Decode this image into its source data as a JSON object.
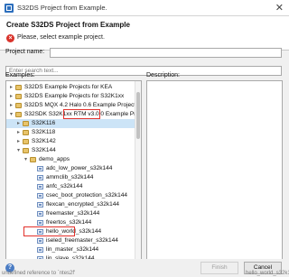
{
  "window": {
    "title": "S32DS Project from Example."
  },
  "header": {
    "title": "Create S32DS Project from Example",
    "message": "Please, select example project."
  },
  "form": {
    "project_name_label": "Project name:",
    "search_placeholder": "Enter search text...",
    "examples_label": "Examples:",
    "description_label": "Description:"
  },
  "tree": [
    {
      "label": "S32DS Example Projects for KEA",
      "toggle": "▸",
      "type": "folder",
      "level": 0
    },
    {
      "label": "S32DS Example Projects for S32K1xx",
      "toggle": "▸",
      "type": "folder",
      "level": 0
    },
    {
      "label": "S32DS MQX 4.2 Halo 0.6 Example Projects",
      "toggle": "▸",
      "type": "folder",
      "level": 0
    },
    {
      "label": "S32SDK S32K1xx RTM v3.0.0 Example Proj",
      "toggle": "▾",
      "type": "folder",
      "level": 0
    },
    {
      "label": "S32K116",
      "toggle": "▸",
      "type": "folder",
      "level": 1,
      "selected": true
    },
    {
      "label": "S32K118",
      "toggle": "▸",
      "type": "folder",
      "level": 1
    },
    {
      "label": "S32K142",
      "toggle": "▸",
      "type": "folder",
      "level": 1
    },
    {
      "label": "S32K144",
      "toggle": "▾",
      "type": "folder",
      "level": 1
    },
    {
      "label": "demo_apps",
      "toggle": "▾",
      "type": "folder",
      "level": 2
    },
    {
      "label": "adc_low_power_s32k144",
      "toggle": "",
      "type": "project",
      "level": 3
    },
    {
      "label": "ammclib_s32k144",
      "toggle": "",
      "type": "project",
      "level": 3
    },
    {
      "label": "anfc_s32k144",
      "toggle": "",
      "type": "project",
      "level": 3
    },
    {
      "label": "csec_boot_protection_s32k144",
      "toggle": "",
      "type": "project",
      "level": 3
    },
    {
      "label": "flexcan_encrypted_s32k144",
      "toggle": "",
      "type": "project",
      "level": 3
    },
    {
      "label": "freemaster_s32k144",
      "toggle": "",
      "type": "project",
      "level": 3
    },
    {
      "label": "freertos_s32k144",
      "toggle": "",
      "type": "project",
      "level": 3
    },
    {
      "label": "hello_world_s32k144",
      "toggle": "",
      "type": "project",
      "level": 3
    },
    {
      "label": "iseled_freemaster_s32k144",
      "toggle": "",
      "type": "project",
      "level": 3
    },
    {
      "label": "lin_master_s32k144",
      "toggle": "",
      "type": "project",
      "level": 3
    },
    {
      "label": "lin_slave_s32k144",
      "toggle": "",
      "type": "project",
      "level": 3
    }
  ],
  "buttons": {
    "finish": "Finish",
    "cancel": "Cancel"
  },
  "status": {
    "left": "undefined reference to `ntes2f'",
    "right": "hello_world_s32k144"
  }
}
